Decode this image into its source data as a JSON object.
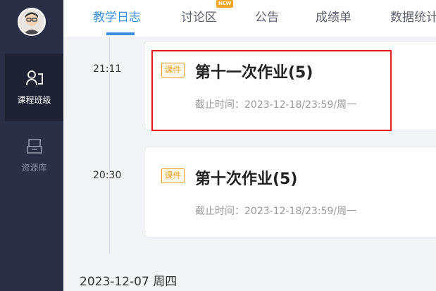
{
  "sidebar": {
    "items": [
      {
        "label": "课程班级",
        "icon": "class-icon",
        "active": true
      },
      {
        "label": "资源库",
        "icon": "library-icon",
        "active": false
      }
    ]
  },
  "tabs": [
    {
      "label": "教学日志",
      "active": true
    },
    {
      "label": "讨论区",
      "badge": "NEW"
    },
    {
      "label": "公告"
    },
    {
      "label": "成绩单"
    },
    {
      "label": "数据统计"
    }
  ],
  "timeline": {
    "entries": [
      {
        "time": "21:11",
        "tag": "课件",
        "title": "第十一次作业(5)",
        "deadline": "截止时间：2023-12-18/23:59/周一",
        "highlighted": true
      },
      {
        "time": "20:30",
        "tag": "课件",
        "title": "第十次作业(5)",
        "deadline": "截止时间：2023-12-18/23:59/周一",
        "highlighted": false
      }
    ],
    "next_date": "2023-12-07 周四"
  },
  "colors": {
    "accent": "#3a8ee6",
    "sidebar": "#2b2f45",
    "tag": "#f0a020",
    "highlight": "#e02020"
  }
}
